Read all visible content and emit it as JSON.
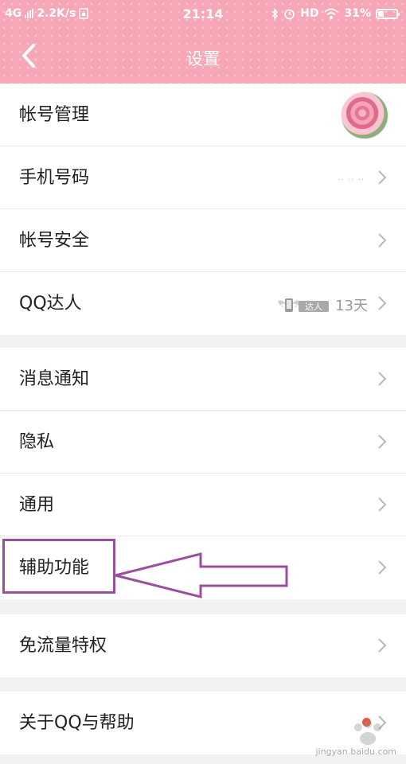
{
  "status_bar": {
    "network": "4G",
    "speed": "2.2K/s",
    "time": "21:14",
    "hd": "HD",
    "battery": "31%",
    "battery_fraction": 0.31
  },
  "nav": {
    "title": "设置"
  },
  "groups": [
    {
      "rows": [
        {
          "label": "帐号管理"
        },
        {
          "label": "手机号码",
          "value": "·· ·· ··"
        },
        {
          "label": "帐号安全"
        },
        {
          "label": "QQ达人",
          "badge": "达人",
          "days": "13天"
        }
      ]
    },
    {
      "rows": [
        {
          "label": "消息通知"
        },
        {
          "label": "隐私"
        },
        {
          "label": "通用"
        },
        {
          "label": "辅助功能"
        }
      ]
    },
    {
      "rows": [
        {
          "label": "免流量特权"
        }
      ]
    },
    {
      "rows": [
        {
          "label": "关于QQ与帮助"
        }
      ]
    }
  ],
  "watermark": {
    "text": "jingyan.baidu.com"
  },
  "colors": {
    "header": "#f7a7b6",
    "highlight": "#9a4f9e",
    "red_dot": "#f0553f"
  }
}
